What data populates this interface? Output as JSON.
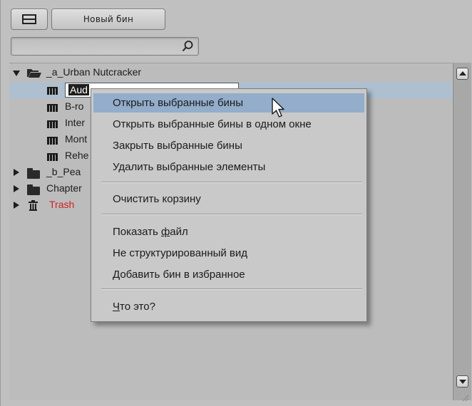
{
  "toolbar": {
    "view_toggle_icon": "panel-split-icon",
    "new_bin_label": "Новый бин"
  },
  "search": {
    "value": "",
    "icon": "search-icon"
  },
  "tree": {
    "root": {
      "label": "_a_Urban Nutcracker",
      "expanded": true,
      "icon": "folder-open-icon"
    },
    "rename_text": "Aud",
    "children": [
      {
        "label": "B-ro"
      },
      {
        "label": "Inter"
      },
      {
        "label": "Mont"
      },
      {
        "label": "Rehe"
      }
    ],
    "folders": [
      {
        "label": "_b_Pea"
      },
      {
        "label": "Chapter"
      }
    ],
    "trash": {
      "label": "Trash",
      "color": "#d41f1f"
    }
  },
  "context_menu": {
    "items": [
      {
        "label": "Открыть выбранные бины",
        "highlighted": true
      },
      {
        "label": "Открыть выбранные бины в одном окне"
      },
      {
        "label": "Закрыть выбранные бины"
      },
      {
        "label": "Удалить выбранные элементы"
      },
      {
        "label": "Очистить корзину"
      },
      {
        "label_pre": "Показать ",
        "label_u": "ф",
        "label_post": "айл"
      },
      {
        "label": "Не структурированный вид"
      },
      {
        "label": "Добавить бин в избранное"
      },
      {
        "label_u": "Ч",
        "label_post": "то это?"
      }
    ]
  },
  "colors": {
    "selection": "#aebfcf",
    "menu_highlight": "#93adcb",
    "trash_text": "#d41f1f"
  }
}
